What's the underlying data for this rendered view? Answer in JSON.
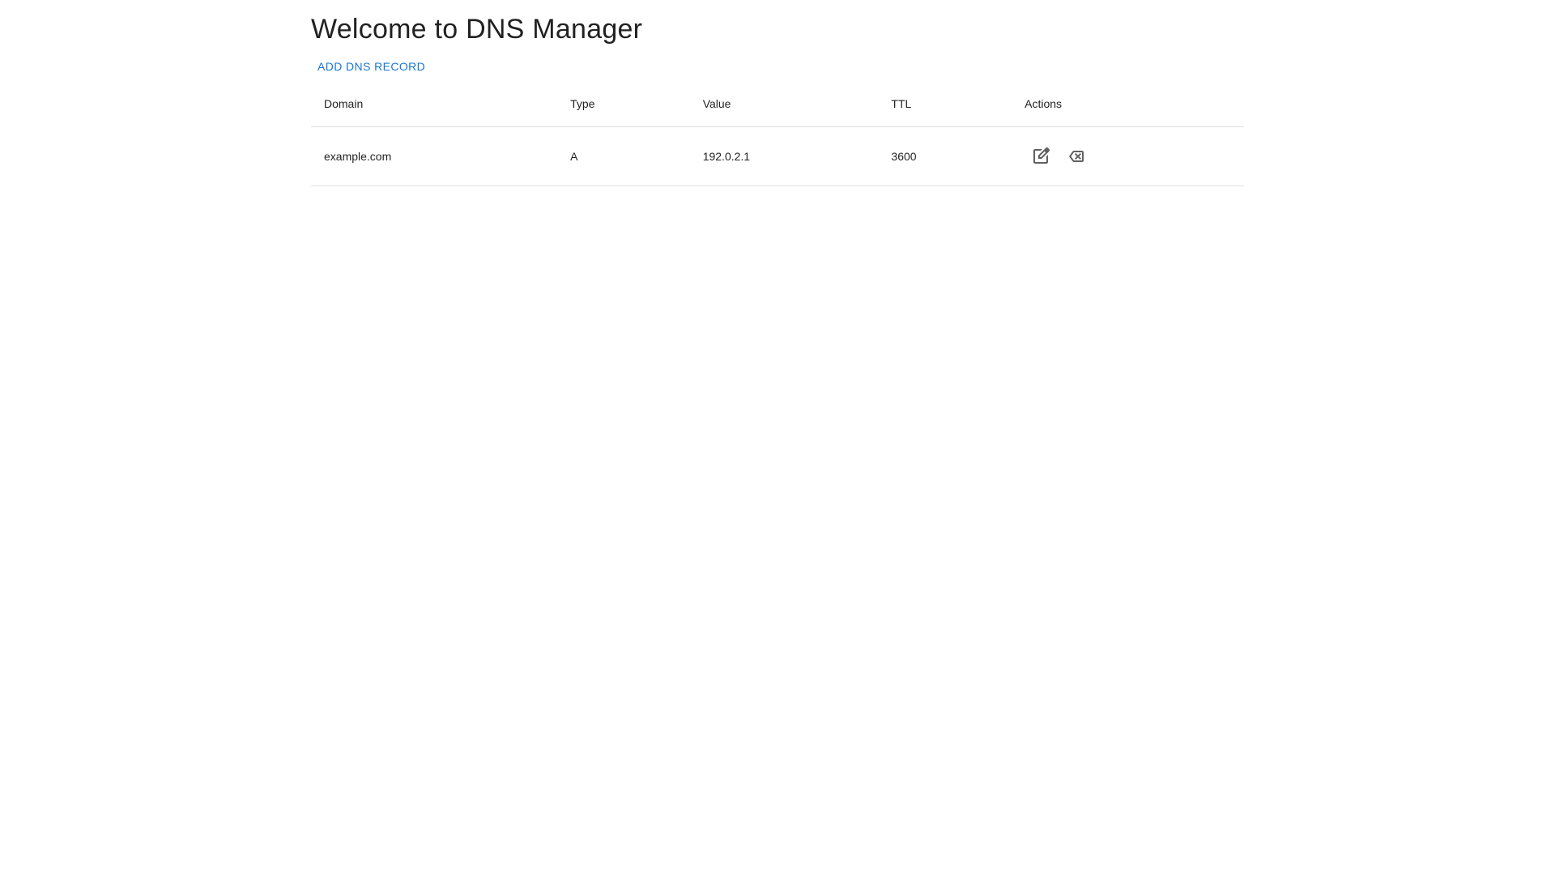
{
  "page": {
    "title": "Welcome to DNS Manager"
  },
  "toolbar": {
    "add_button_label": "ADD DNS RECORD"
  },
  "table": {
    "columns": [
      "Domain",
      "Type",
      "Value",
      "TTL",
      "Actions"
    ],
    "rows": [
      {
        "domain": "example.com",
        "type": "A",
        "value": "192.0.2.1",
        "ttl": "3600"
      }
    ],
    "row_actions": [
      "edit",
      "delete"
    ]
  },
  "icons": {
    "edit": "edit-square-icon",
    "delete": "backspace-icon"
  },
  "colors": {
    "accent_blue": "#1976d2",
    "icon_gray": "#616161",
    "divider": "#e0e0e0",
    "text_primary": "#212121",
    "background": "#ffffff"
  }
}
